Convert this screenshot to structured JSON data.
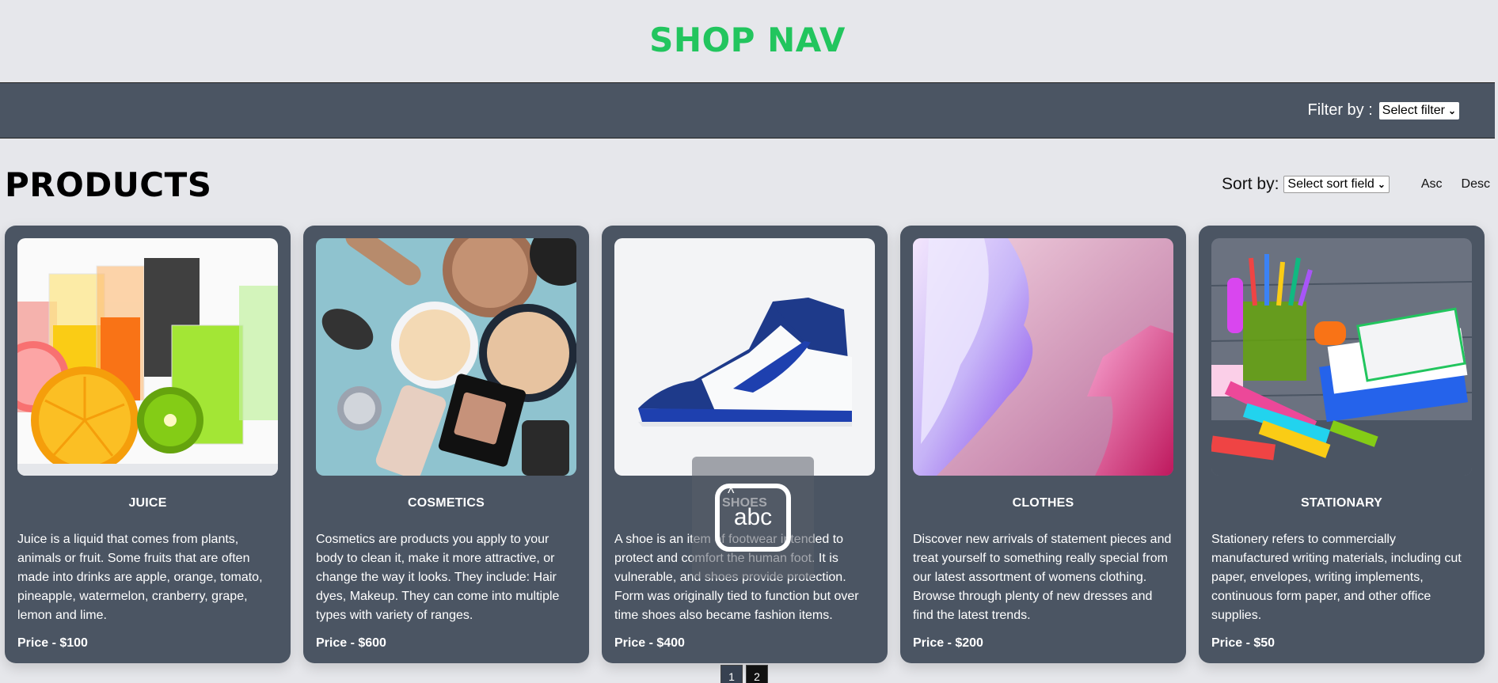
{
  "header": {
    "title": "SHOP NAV"
  },
  "filter": {
    "label": "Filter by :",
    "selected": "Select filter"
  },
  "main": {
    "title": "PRODUCTS",
    "sort": {
      "label": "Sort by:",
      "selected": "Select sort field",
      "asc_label": "Asc",
      "desc_label": "Desc"
    }
  },
  "products": [
    {
      "title": "JUICE",
      "description": "Juice is a liquid that comes from plants, animals or fruit. Some fruits that are often made into drinks are apple, orange, tomato, pineapple, watermelon, cranberry, grape, lemon and lime.",
      "price": "Price - $100",
      "image_icon": "juice-image"
    },
    {
      "title": "COSMETICS",
      "description": "Cosmetics are products you apply to your body to clean it, make it more attractive, or change the way it looks. They include: Hair dyes, Makeup. They can come into multiple types with variety of ranges.",
      "price": "Price - $600",
      "image_icon": "cosmetics-image"
    },
    {
      "title": "SHOES",
      "description": "A shoe is an item of footwear intended to protect and comfort the human foot. It is vulnerable, and shoes provide protection. Form was originally tied to function but over time shoes also became fashion items.",
      "price": "Price - $400",
      "image_icon": "shoe-image"
    },
    {
      "title": "CLOTHES",
      "description": "Discover new arrivals of statement pieces and treat yourself to something really special from our latest assortment of womens clothing. Browse through plenty of new dresses and find the latest trends.",
      "price": "Price - $200",
      "image_icon": "clothes-image"
    },
    {
      "title": "STATIONARY",
      "description": "Stationery refers to commercially manufactured writing materials, including cut paper, envelopes, writing implements, continuous form paper, and other office supplies.",
      "price": "Price - $50",
      "image_icon": "stationery-image"
    }
  ],
  "pagination": {
    "pages": [
      "1",
      "2"
    ],
    "current": "1"
  },
  "overlay": {
    "text": "abc",
    "icon": "keyboard-input-icon"
  },
  "colors": {
    "brand": "#22c55e",
    "bar": "#4b5563",
    "background": "#e6e7eb"
  }
}
